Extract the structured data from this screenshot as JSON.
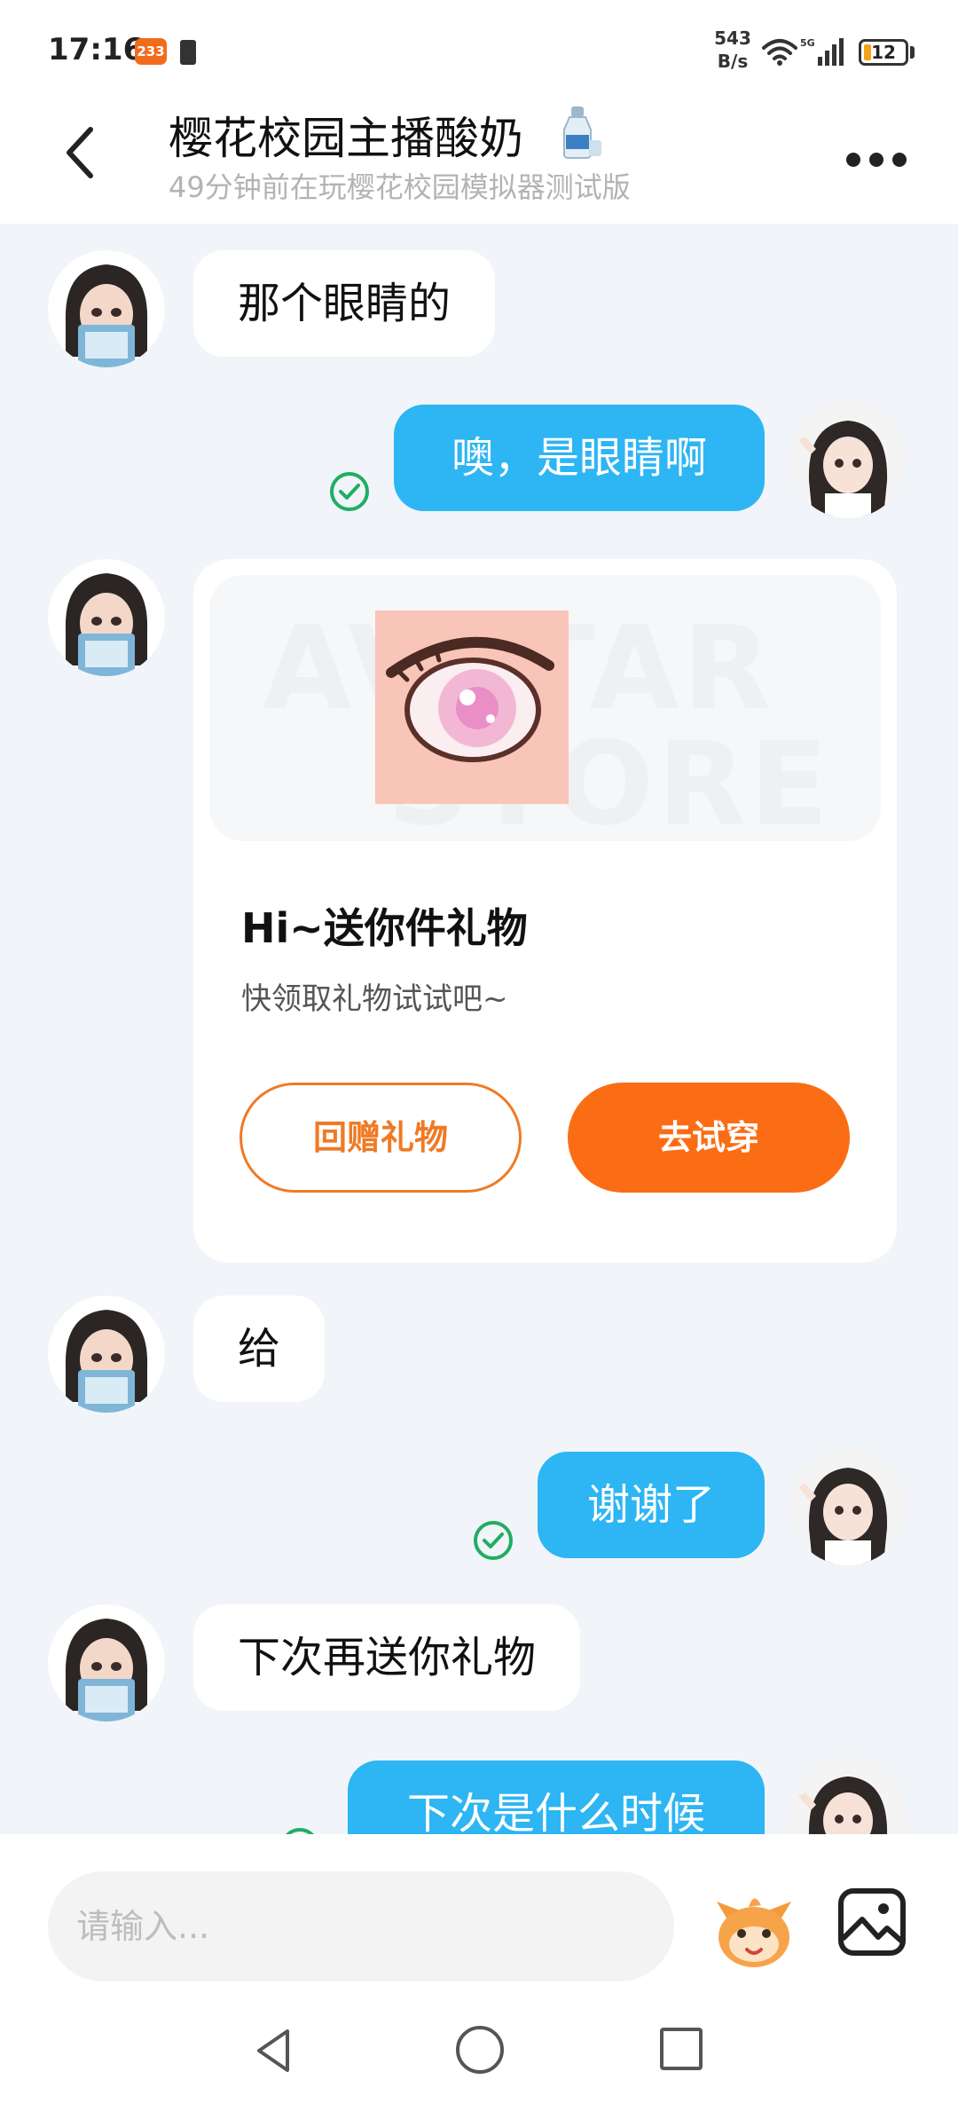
{
  "status_bar": {
    "time": "17:16",
    "app_badge": "233",
    "net_speed_value": "543",
    "net_speed_unit": "B/s",
    "battery": "12"
  },
  "header": {
    "title": "樱花校园主播酸奶",
    "subtitle": "49分钟前在玩樱花校园模拟器测试版"
  },
  "messages": [
    {
      "side": "in",
      "text": "那个眼睛的"
    },
    {
      "side": "out",
      "text": "噢，是眼睛啊"
    },
    {
      "side": "in",
      "type": "gift_card"
    },
    {
      "side": "in",
      "text": "给"
    },
    {
      "side": "out",
      "text": "谢谢了"
    },
    {
      "side": "in",
      "text": "下次再送你礼物"
    },
    {
      "side": "out",
      "text": "下次是什么时候"
    }
  ],
  "gift_card": {
    "watermark_line1": "AVATAR",
    "watermark_line2": "STORE",
    "title": "Hi~送你件礼物",
    "description": "快领取礼物试试吧~",
    "return_gift_label": "回赠礼物",
    "try_on_label": "去试穿"
  },
  "input": {
    "placeholder": "请输入..."
  },
  "colors": {
    "outgoing_bubble": "#2db5f4",
    "accent_orange": "#fb6d14",
    "read_check": "#1fae62",
    "chat_background": "#f1f4f8"
  },
  "icons": [
    "back-icon",
    "bottle-icon",
    "more-icon",
    "check-icon",
    "emoji-mascot-icon",
    "image-icon",
    "nav-back-icon",
    "nav-home-icon",
    "nav-recent-icon"
  ]
}
